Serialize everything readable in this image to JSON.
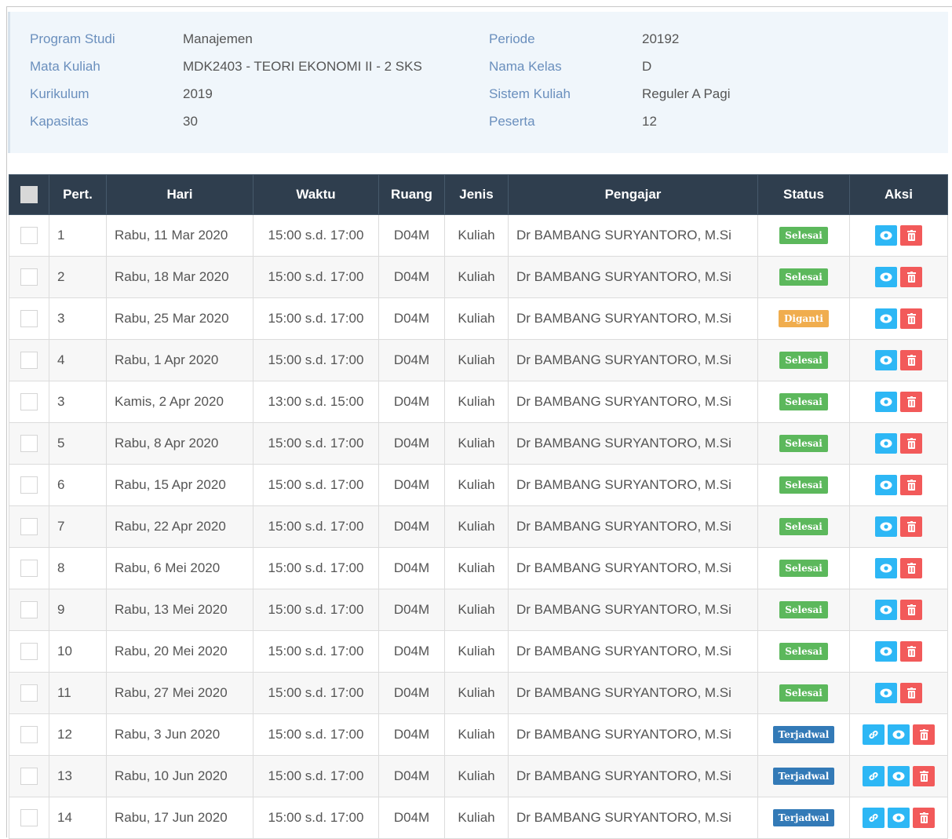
{
  "info": {
    "left": [
      {
        "label": "Program Studi",
        "value": "Manajemen"
      },
      {
        "label": "Mata Kuliah",
        "value": "MDK2403 - TEORI EKONOMI II - 2 SKS"
      },
      {
        "label": "Kurikulum",
        "value": "2019"
      },
      {
        "label": "Kapasitas",
        "value": "30"
      }
    ],
    "right": [
      {
        "label": "Periode",
        "value": "20192"
      },
      {
        "label": "Nama Kelas",
        "value": "D"
      },
      {
        "label": "Sistem Kuliah",
        "value": "Reguler A Pagi"
      },
      {
        "label": "Peserta",
        "value": "12"
      }
    ]
  },
  "table": {
    "headers": [
      "",
      "Pert.",
      "Hari",
      "Waktu",
      "Ruang",
      "Jenis",
      "Pengajar",
      "Status",
      "Aksi"
    ],
    "rows": [
      {
        "pert": "1",
        "hari": "Rabu, 11 Mar 2020",
        "waktu": "15:00 s.d. 17:00",
        "ruang": "D04M",
        "jenis": "Kuliah",
        "pengajar": "Dr BAMBANG SURYANTORO, M.Si",
        "status": "Selesai",
        "status_color": "#5cb85c",
        "actions": [
          "view-icon",
          "delete-icon"
        ]
      },
      {
        "pert": "2",
        "hari": "Rabu, 18 Mar 2020",
        "waktu": "15:00 s.d. 17:00",
        "ruang": "D04M",
        "jenis": "Kuliah",
        "pengajar": "Dr BAMBANG SURYANTORO, M.Si",
        "status": "Selesai",
        "status_color": "#5cb85c",
        "actions": [
          "view-icon",
          "delete-icon"
        ]
      },
      {
        "pert": "3",
        "hari": "Rabu, 25 Mar 2020",
        "waktu": "15:00 s.d. 17:00",
        "ruang": "D04M",
        "jenis": "Kuliah",
        "pengajar": "Dr BAMBANG SURYANTORO, M.Si",
        "status": "Diganti",
        "status_color": "#f0ad4e",
        "actions": [
          "view-icon",
          "delete-icon"
        ]
      },
      {
        "pert": "4",
        "hari": "Rabu, 1 Apr 2020",
        "waktu": "15:00 s.d. 17:00",
        "ruang": "D04M",
        "jenis": "Kuliah",
        "pengajar": "Dr BAMBANG SURYANTORO, M.Si",
        "status": "Selesai",
        "status_color": "#5cb85c",
        "actions": [
          "view-icon",
          "delete-icon"
        ]
      },
      {
        "pert": "3",
        "hari": "Kamis, 2 Apr 2020",
        "waktu": "13:00 s.d. 15:00",
        "ruang": "D04M",
        "jenis": "Kuliah",
        "pengajar": "Dr BAMBANG SURYANTORO, M.Si",
        "status": "Selesai",
        "status_color": "#5cb85c",
        "actions": [
          "view-icon",
          "delete-icon"
        ]
      },
      {
        "pert": "5",
        "hari": "Rabu, 8 Apr 2020",
        "waktu": "15:00 s.d. 17:00",
        "ruang": "D04M",
        "jenis": "Kuliah",
        "pengajar": "Dr BAMBANG SURYANTORO, M.Si",
        "status": "Selesai",
        "status_color": "#5cb85c",
        "actions": [
          "view-icon",
          "delete-icon"
        ]
      },
      {
        "pert": "6",
        "hari": "Rabu, 15 Apr 2020",
        "waktu": "15:00 s.d. 17:00",
        "ruang": "D04M",
        "jenis": "Kuliah",
        "pengajar": "Dr BAMBANG SURYANTORO, M.Si",
        "status": "Selesai",
        "status_color": "#5cb85c",
        "actions": [
          "view-icon",
          "delete-icon"
        ]
      },
      {
        "pert": "7",
        "hari": "Rabu, 22 Apr 2020",
        "waktu": "15:00 s.d. 17:00",
        "ruang": "D04M",
        "jenis": "Kuliah",
        "pengajar": "Dr BAMBANG SURYANTORO, M.Si",
        "status": "Selesai",
        "status_color": "#5cb85c",
        "actions": [
          "view-icon",
          "delete-icon"
        ]
      },
      {
        "pert": "8",
        "hari": "Rabu, 6 Mei 2020",
        "waktu": "15:00 s.d. 17:00",
        "ruang": "D04M",
        "jenis": "Kuliah",
        "pengajar": "Dr BAMBANG SURYANTORO, M.Si",
        "status": "Selesai",
        "status_color": "#5cb85c",
        "actions": [
          "view-icon",
          "delete-icon"
        ]
      },
      {
        "pert": "9",
        "hari": "Rabu, 13 Mei 2020",
        "waktu": "15:00 s.d. 17:00",
        "ruang": "D04M",
        "jenis": "Kuliah",
        "pengajar": "Dr BAMBANG SURYANTORO, M.Si",
        "status": "Selesai",
        "status_color": "#5cb85c",
        "actions": [
          "view-icon",
          "delete-icon"
        ]
      },
      {
        "pert": "10",
        "hari": "Rabu, 20 Mei 2020",
        "waktu": "15:00 s.d. 17:00",
        "ruang": "D04M",
        "jenis": "Kuliah",
        "pengajar": "Dr BAMBANG SURYANTORO, M.Si",
        "status": "Selesai",
        "status_color": "#5cb85c",
        "actions": [
          "view-icon",
          "delete-icon"
        ]
      },
      {
        "pert": "11",
        "hari": "Rabu, 27 Mei 2020",
        "waktu": "15:00 s.d. 17:00",
        "ruang": "D04M",
        "jenis": "Kuliah",
        "pengajar": "Dr BAMBANG SURYANTORO, M.Si",
        "status": "Selesai",
        "status_color": "#5cb85c",
        "actions": [
          "view-icon",
          "delete-icon"
        ]
      },
      {
        "pert": "12",
        "hari": "Rabu, 3 Jun 2020",
        "waktu": "15:00 s.d. 17:00",
        "ruang": "D04M",
        "jenis": "Kuliah",
        "pengajar": "Dr BAMBANG SURYANTORO, M.Si",
        "status": "Terjadwal",
        "status_color": "#337ab7",
        "actions": [
          "link-icon",
          "view-icon",
          "delete-icon"
        ]
      },
      {
        "pert": "13",
        "hari": "Rabu, 10 Jun 2020",
        "waktu": "15:00 s.d. 17:00",
        "ruang": "D04M",
        "jenis": "Kuliah",
        "pengajar": "Dr BAMBANG SURYANTORO, M.Si",
        "status": "Terjadwal",
        "status_color": "#337ab7",
        "actions": [
          "link-icon",
          "view-icon",
          "delete-icon"
        ]
      },
      {
        "pert": "14",
        "hari": "Rabu, 17 Jun 2020",
        "waktu": "15:00 s.d. 17:00",
        "ruang": "D04M",
        "jenis": "Kuliah",
        "pengajar": "Dr BAMBANG SURYANTORO, M.Si",
        "status": "Terjadwal",
        "status_color": "#337ab7",
        "actions": [
          "link-icon",
          "view-icon",
          "delete-icon"
        ]
      }
    ]
  }
}
